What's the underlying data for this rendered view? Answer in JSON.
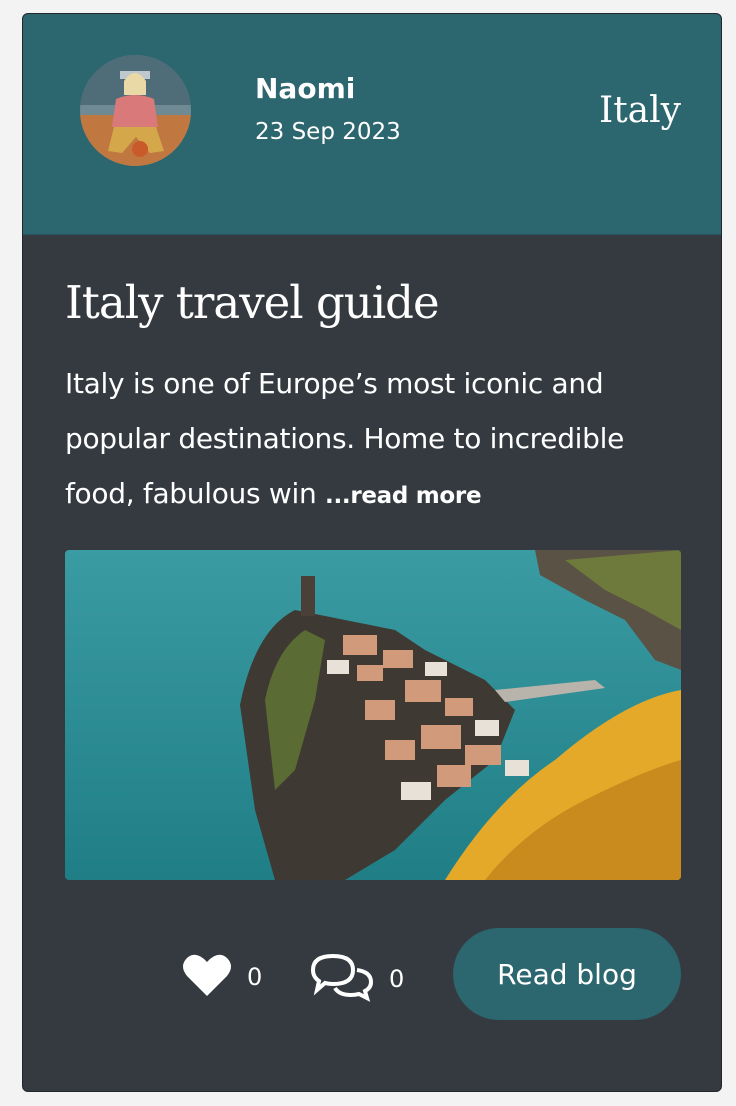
{
  "post": {
    "author": {
      "name": "Naomi",
      "avatar_icon": "user-avatar-photo"
    },
    "date": "23 Sep 2023",
    "category": "Italy",
    "title": "Italy travel guide",
    "excerpt": "Italy is one of Europe’s most iconic and popular destinations. Home to incredible food, fabulous win",
    "read_more_label": "...read more",
    "image_icon": "coastal-village-photo",
    "likes": {
      "icon": "heart-icon",
      "count": "0"
    },
    "comments": {
      "icon": "comments-icon",
      "count": "0"
    },
    "read_blog_label": "Read blog"
  },
  "colors": {
    "header_bg": "#2c666e",
    "card_bg": "#343a40",
    "page_bg": "#f3f3f4",
    "text": "#ffffff"
  }
}
